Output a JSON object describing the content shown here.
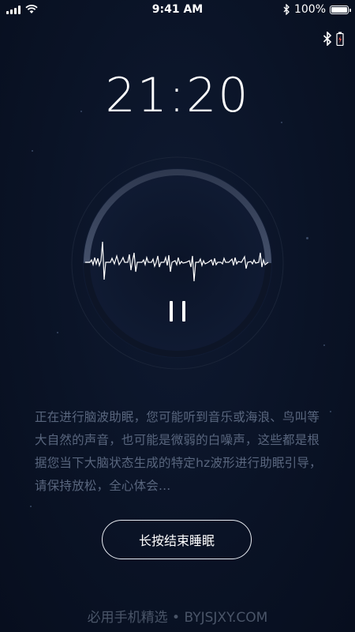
{
  "status_bar": {
    "time": "9:41 AM",
    "battery_text": "100%",
    "battery_level": 1.0
  },
  "device_status": {
    "bluetooth_icon": "bluetooth-icon",
    "battery_icon": "battery-charging-icon",
    "battery_color": "#e0564d"
  },
  "main": {
    "clock": "21:20"
  },
  "player": {
    "state": "playing",
    "wave_icon": "waveform-icon",
    "pause_icon": "pause-icon"
  },
  "description": "正在进行脑波助眠，您可能听到音乐或海浪、鸟叫等大自然的声音，也可能是微弱的白噪声，这些都是根据您当下大脑状态生成的特定hz波形进行助眠引导，请保持放松，全心体会...",
  "end_button": {
    "label": "长按结束睡眠"
  },
  "watermark": "必用手机精选 • BYJSJXY.COM",
  "colors": {
    "background": "#0a1326",
    "text_muted": "#59667e",
    "ring": "#3a4459"
  }
}
